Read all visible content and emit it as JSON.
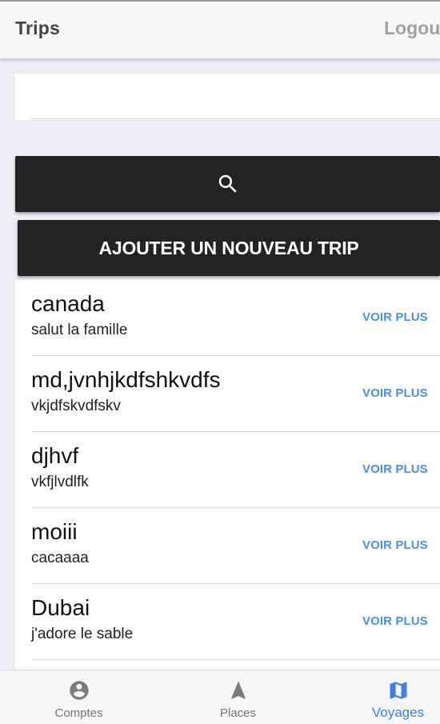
{
  "header": {
    "title": "Trips",
    "logout_label": "Logout"
  },
  "search": {
    "value": "",
    "placeholder": ""
  },
  "add_trip": {
    "label": "AJOUTER UN NOUVEAU TRIP"
  },
  "trips": [
    {
      "name": "canada",
      "description": "salut la famille",
      "action": "VOIR PLUS"
    },
    {
      "name": "md,jvnhjkdfshkvdfs",
      "description": "vkjdfskvdfskv",
      "action": "VOIR PLUS"
    },
    {
      "name": "djhvf",
      "description": "vkfjlvdlfk",
      "action": "VOIR PLUS"
    },
    {
      "name": "moiii",
      "description": "cacaaaa",
      "action": "VOIR PLUS"
    },
    {
      "name": "Dubai",
      "description": "j'adore le sable",
      "action": "VOIR PLUS"
    }
  ],
  "bottom_nav": {
    "items": [
      {
        "label": "Comptes",
        "icon": "account-circle-icon"
      },
      {
        "label": "Places",
        "icon": "navigation-arrow-icon"
      },
      {
        "label": "Voyages",
        "icon": "map-icon",
        "active": true
      }
    ]
  },
  "colors": {
    "accent": "#3f7ee8",
    "link": "#4a8df0",
    "button_bg": "#232323",
    "page_bg": "#ededf6"
  }
}
